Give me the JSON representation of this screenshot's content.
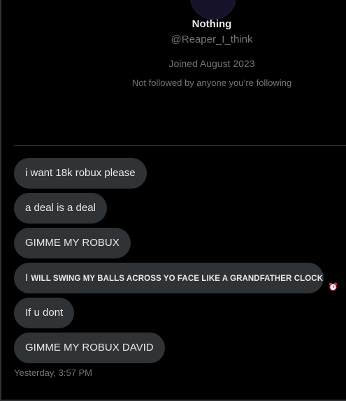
{
  "profile": {
    "display_name": "Nothing",
    "handle": "@Reaper_I_think",
    "joined": "Joined August 2023",
    "follow_status": "Not followed by anyone you’re following"
  },
  "messages": [
    {
      "text": "i want 18k robux please"
    },
    {
      "text": "a deal is a deal"
    },
    {
      "text": "GIMME MY ROBUX"
    },
    {
      "lead": "I",
      "text": "WILL SWING MY BALLS ACROSS YO FACE LIKE A GRANDFATHER CLOCK",
      "emoji_icon": "alarm-clock-icon"
    },
    {
      "text": "If u dont"
    },
    {
      "text": "GIMME MY ROBUX DAVID"
    }
  ],
  "timestamp": "Yesterday, 3:57 PM",
  "colors": {
    "background": "#000000",
    "bubble": "#2f3336",
    "primary_text": "#e7e9ea",
    "secondary_text": "#71767b"
  }
}
